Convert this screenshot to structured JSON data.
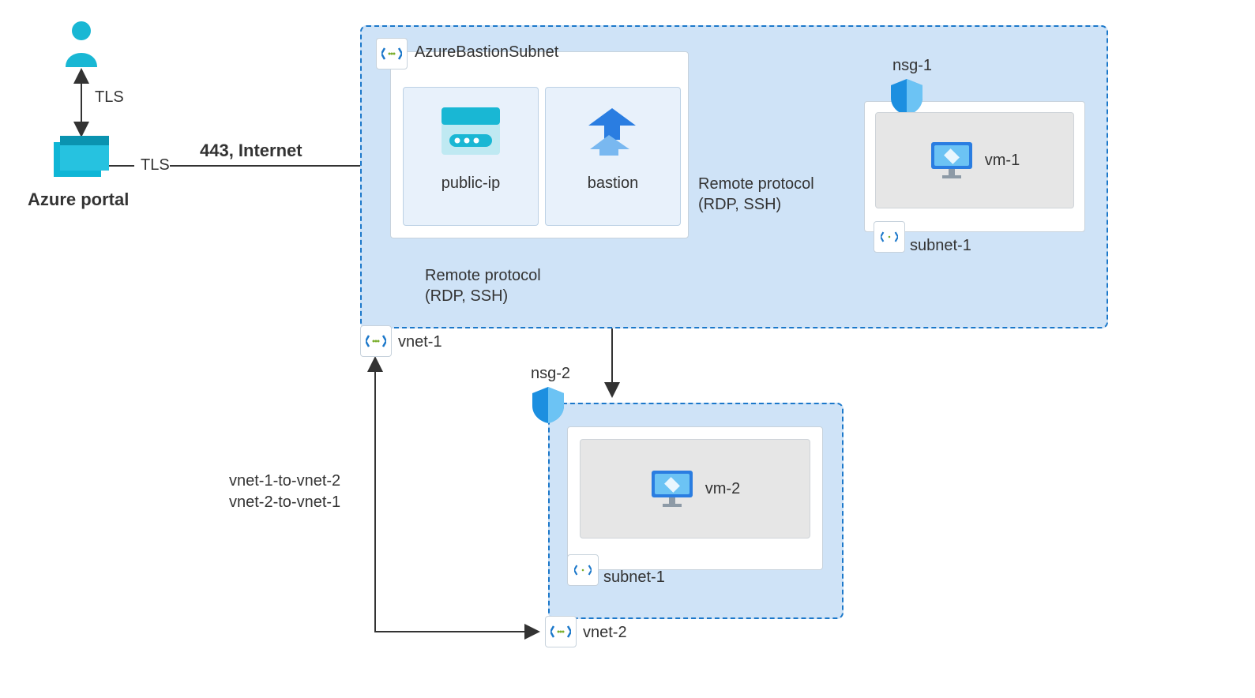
{
  "portal": {
    "title": "Azure portal",
    "tls_user": "TLS",
    "tls_out": "TLS"
  },
  "internet": "443, Internet",
  "vnet1": {
    "name": "vnet-1",
    "bastion_subnet": {
      "name": "AzureBastionSubnet",
      "public_ip": "public-ip",
      "bastion": "bastion"
    },
    "remote_protocol_1": "Remote protocol",
    "remote_protocol_1b": "(RDP, SSH)",
    "remote_protocol_2": "Remote protocol",
    "remote_protocol_2b": "(RDP, SSH)",
    "nsg1": "nsg-1",
    "subnet1": {
      "name": "subnet-1",
      "vm": "vm-1"
    }
  },
  "vnet2": {
    "name": "vnet-2",
    "nsg2": "nsg-2",
    "subnet": {
      "name": "subnet-1",
      "vm": "vm-2"
    }
  },
  "peering": {
    "a": "vnet-1-to-vnet-2",
    "b": "vnet-2-to-vnet-1"
  }
}
